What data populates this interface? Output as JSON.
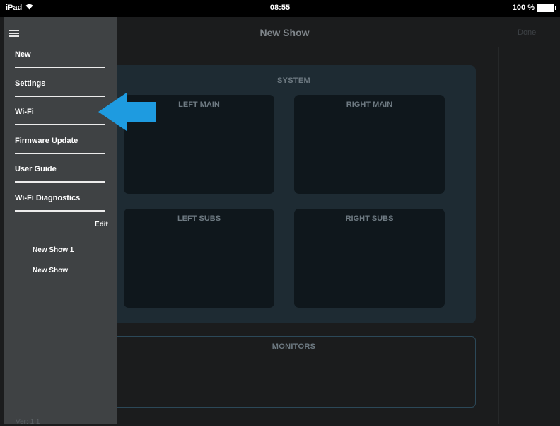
{
  "status_bar": {
    "device": "iPad",
    "time": "08:55",
    "battery": "100 %"
  },
  "nav": {
    "title": "New Show",
    "done_label": "Done"
  },
  "system": {
    "label": "SYSTEM",
    "zones": {
      "left_main": "LEFT MAIN",
      "right_main": "RIGHT MAIN",
      "left_subs": "LEFT SUBS",
      "right_subs": "RIGHT SUBS"
    }
  },
  "monitors": {
    "label": "MONITORS"
  },
  "sidebar": {
    "items": [
      {
        "label": "New"
      },
      {
        "label": "Settings"
      },
      {
        "label": "Wi-Fi"
      },
      {
        "label": "Firmware Update"
      },
      {
        "label": "User Guide"
      },
      {
        "label": "Wi-Fi Diagnostics"
      }
    ],
    "edit_label": "Edit",
    "shows": [
      {
        "label": "New Show 1"
      },
      {
        "label": "New Show"
      }
    ],
    "version": "Ver: 1.1"
  },
  "colors": {
    "sidebar_bg": "#3f4244",
    "panel_bg": "#1e2b33",
    "zone_bg": "#0f171c",
    "arrow": "#1e9be0"
  },
  "icons": {
    "menu": "hamburger-menu-icon",
    "wifi": "wifi-icon",
    "battery": "battery-icon",
    "arrow": "pointer-arrow-icon"
  }
}
